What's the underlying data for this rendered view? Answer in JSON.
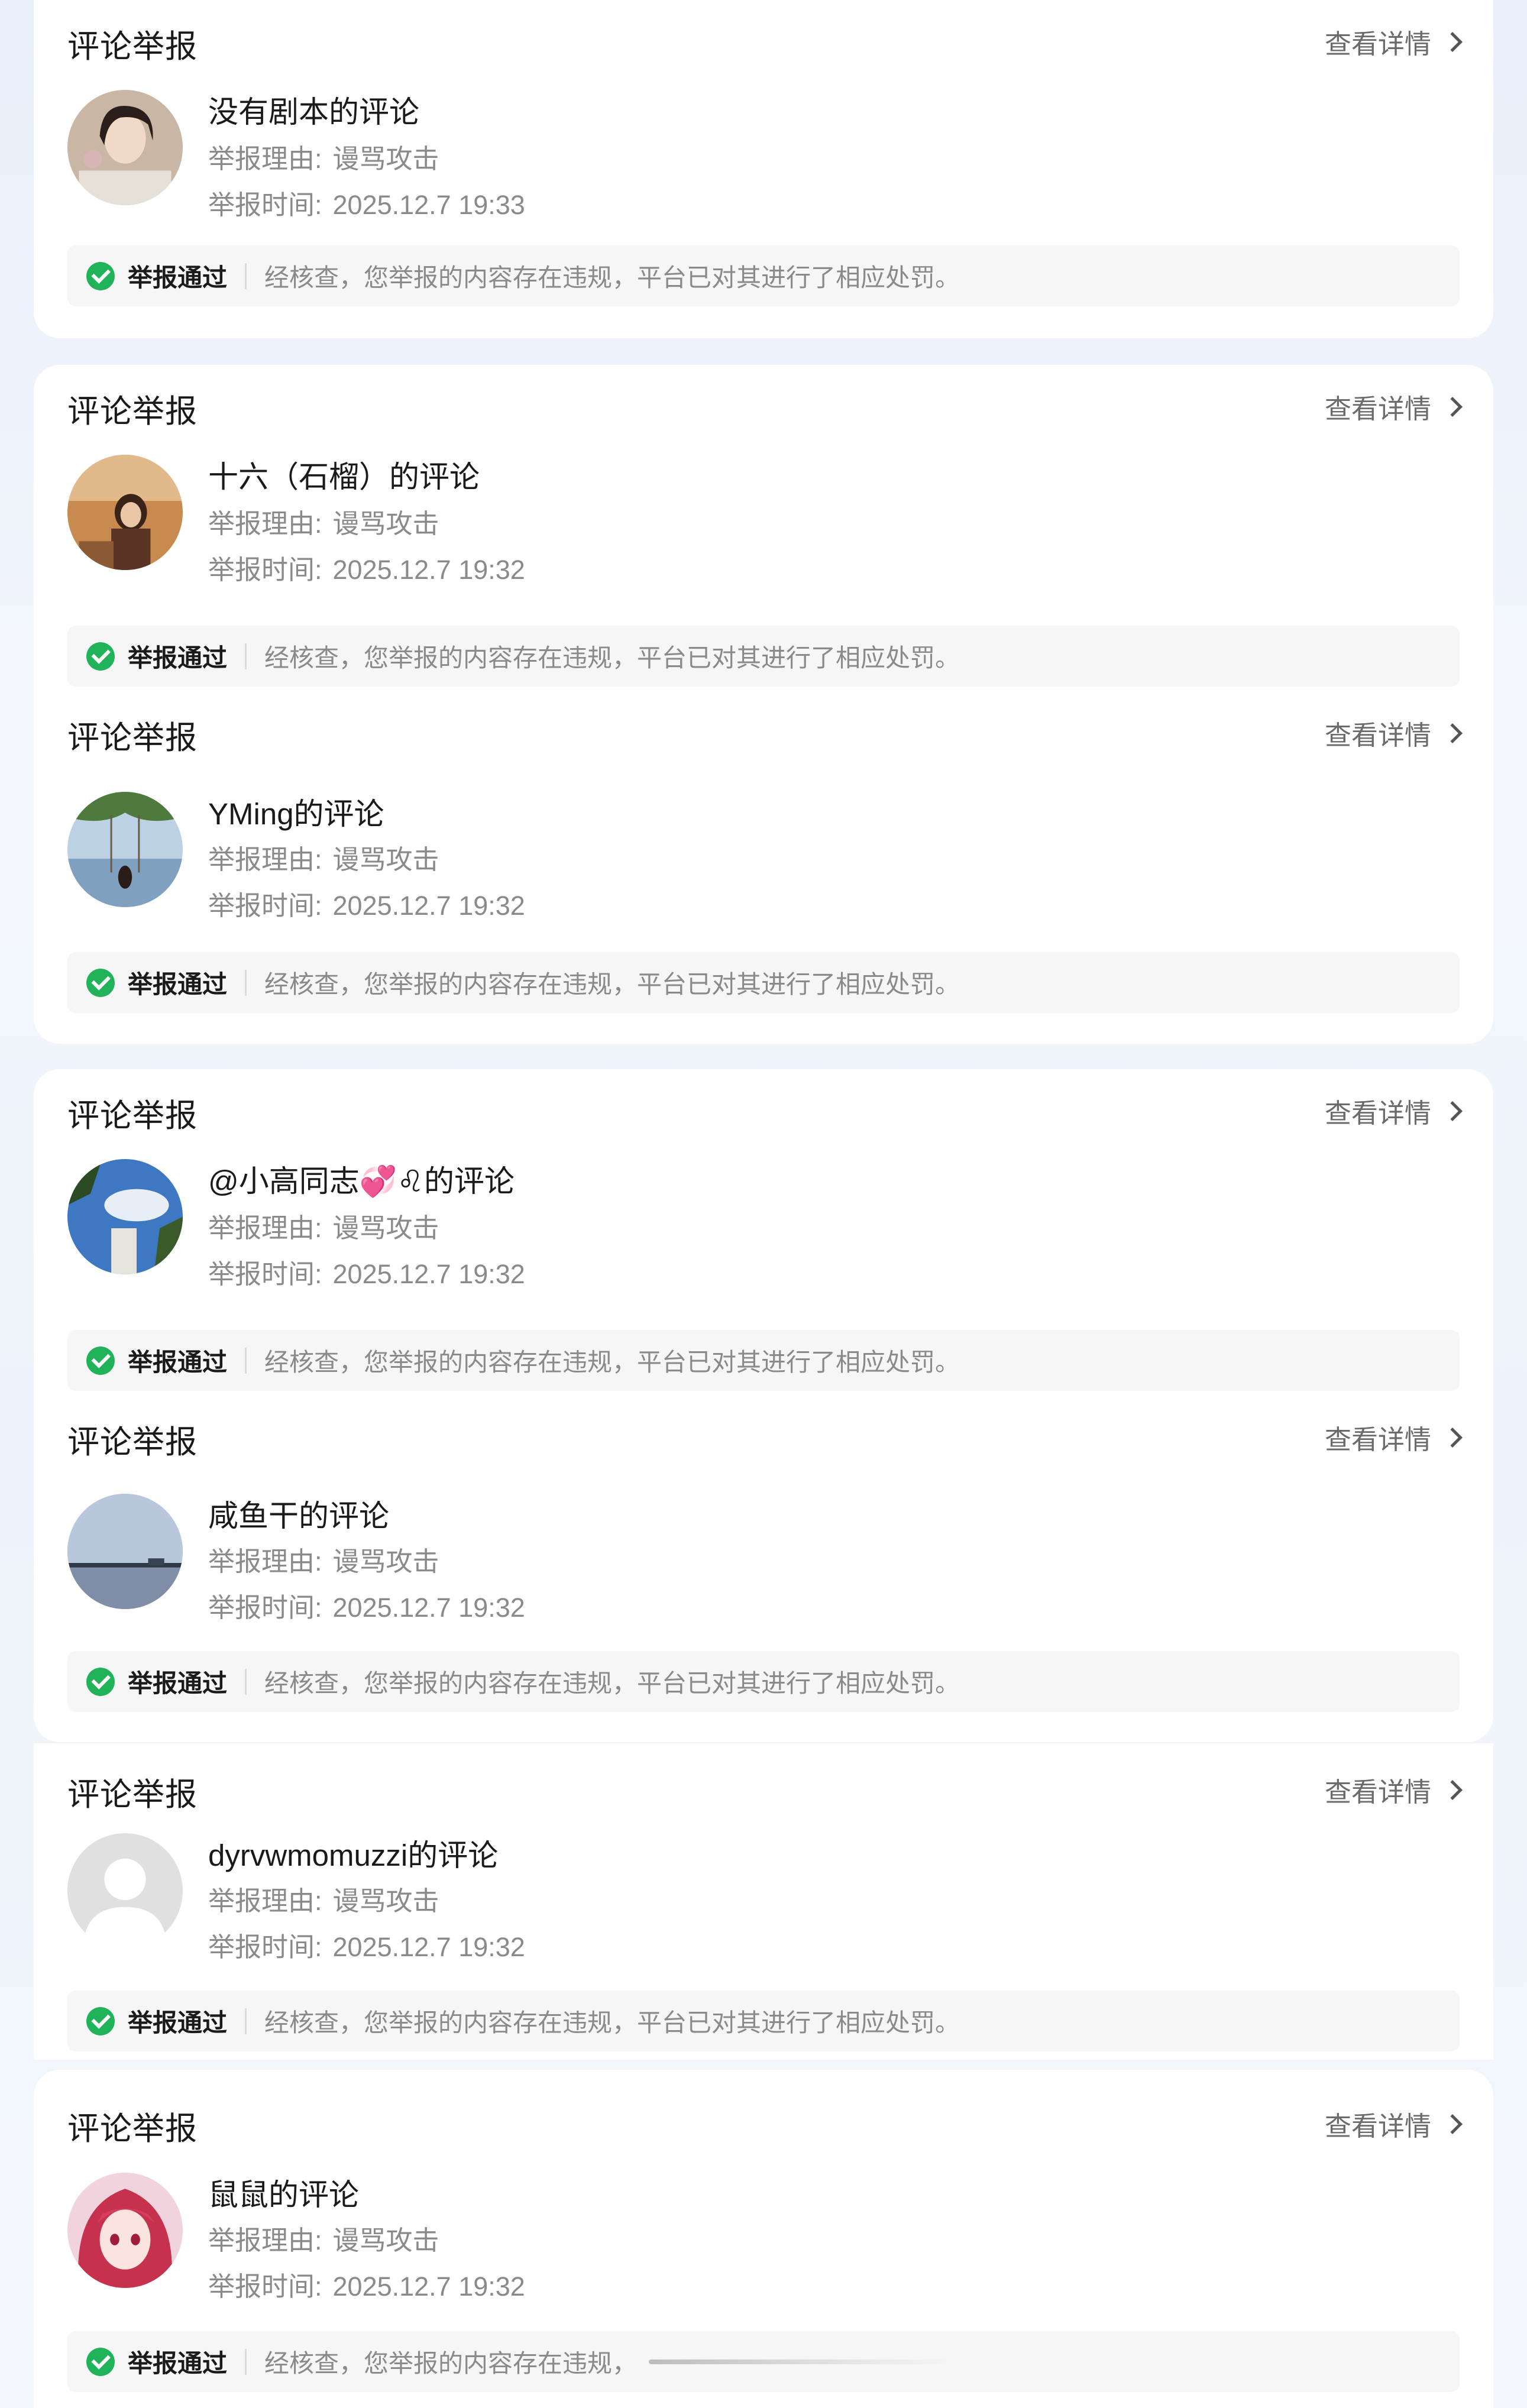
{
  "common": {
    "card_title": "评论举报",
    "detail_label": "查看详情",
    "reason_label": "举报理由:",
    "time_label": "举报时间:",
    "status_label": "举报通过",
    "status_text": "经核查，您举报的内容存在违规，平台已对其进行了相应处罚。"
  },
  "reports": [
    {
      "name": "没有剧本的评论",
      "reason": "谩骂攻击",
      "time": "2025.12.7 19:33",
      "avatar": "portrait-avatar-icon"
    },
    {
      "name": "十六（石榴）的评论",
      "reason": "谩骂攻击",
      "time": "2025.12.7 19:32",
      "avatar": "cafe-girl-avatar-icon"
    },
    {
      "name": "YMing的评论",
      "reason": "谩骂攻击",
      "time": "2025.12.7 19:32",
      "avatar": "seaside-swing-avatar-icon"
    },
    {
      "name": "@小高同志💞♌的评论",
      "reason": "谩骂攻击",
      "time": "2025.12.7 19:32",
      "avatar": "sky-building-avatar-icon"
    },
    {
      "name": "咸鱼干的评论",
      "reason": "谩骂攻击",
      "time": "2025.12.7 19:32",
      "avatar": "lake-horizon-avatar-icon"
    },
    {
      "name": "dyrvwmomuzzi的评论",
      "reason": "谩骂攻击",
      "time": "2025.12.7 19:32",
      "avatar": "default-user-avatar-icon"
    },
    {
      "name": "鼠鼠的评论",
      "reason": "谩骂攻击",
      "time": "2025.12.7 19:32",
      "avatar": "anime-girl-avatar-icon",
      "status_text": "经核查，您举报的内容存在违规，"
    }
  ],
  "colors": {
    "success": "#21b35a",
    "page_bg": "#eef3fb",
    "card_bg": "#ffffff"
  }
}
